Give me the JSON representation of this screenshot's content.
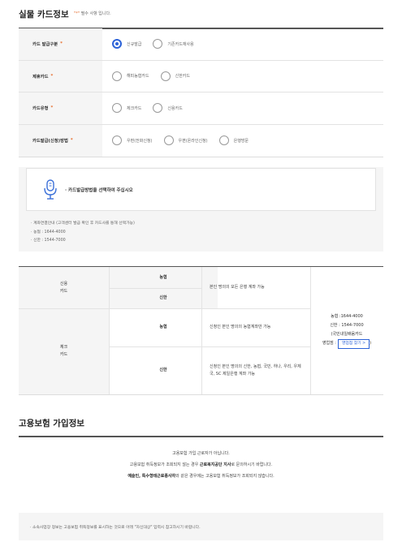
{
  "card_section": {
    "title": "실물 카드정보",
    "required_note_star": "\"*\"",
    "required_note_text": " 필수 사항 입니다."
  },
  "form": {
    "rows": [
      {
        "label": "카드 발급구분",
        "required": "*",
        "options": [
          "신규발급",
          "기존카드재사용"
        ],
        "selected": 0
      },
      {
        "label": "제휴카드",
        "required": "*",
        "options": [
          "해피농협카드",
          "신한카드"
        ],
        "selected": -1
      },
      {
        "label": "카드유형",
        "required": "*",
        "options": [
          "체크카드",
          "신용카드"
        ],
        "selected": -1
      },
      {
        "label": "카드발급(신청)방법",
        "required": "*",
        "options": [
          "우편(전화신청)",
          "우편(온라인신청)",
          "은행방문"
        ],
        "selected": -1
      }
    ]
  },
  "guide": {
    "message": "· 카드발급방법을 선택하여 주십시오",
    "items": [
      "계좌연결안내 (고객센터 발급 확인 후 카드사를 통해 선택가능)",
      "농협 : 1644-4000",
      "신한 : 1544-7000"
    ]
  },
  "bank_table": {
    "credit_card": "신용\n카드",
    "check_card": "체크\n카드",
    "nh": "농협",
    "shinhan": "신한",
    "desc_credit": "본인 명의의 모든 은행 계좌 가능",
    "desc_check_nh": "신청인 본인 명의의 농협계좌만 가능",
    "desc_check_shinhan": "신청인 본인 명의의 신한, 농협, 국민, 하나, 우리, 우체국, SC 제일은행 계좌 가능",
    "contact_nh": "농협 :1644-4000",
    "contact_shinhan": "신한 : 1544-7000",
    "contact_note": "(국민내일배움카드",
    "branch_label": "영업점 :",
    "find_branch_button": "영업점 찾기 >",
    "close_paren": ")"
  },
  "insurance_section": {
    "title": "고용보험 가입정보",
    "line1": "고용보험 가입 근로자가 아닙니다.",
    "line2_pre": "고용보험 취득정보가 조회되지 않는 경우 ",
    "line2_bold": "근로복지공단 지사",
    "line2_post": "로 문의하시기 바랍니다.",
    "line3_bold": "예술인, 특수형태근로종사자",
    "line3_post": "와 같은 경우에는 고용보험 취득정보가 조회되지 않습니다.",
    "bottom_note": "· 소속사업장 정보는 고용보험 취득정보를 표시하는 것으로 아래 \"자신대상\" 입력시 참고하시기 바랍니다."
  },
  "colors": {
    "accent": "#2d63d8",
    "required_star": "#e66a28",
    "header_bg": "#f5f5f5"
  },
  "icons": {
    "guide": "microphone-icon"
  }
}
